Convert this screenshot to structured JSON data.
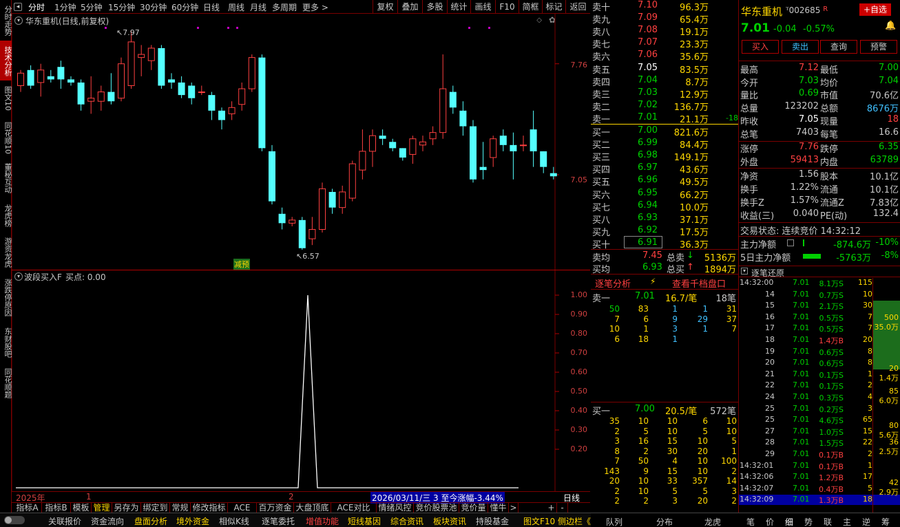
{
  "left_tabs": [
    {
      "label": "分时走势",
      "active": false
    },
    {
      "label": "技术分析",
      "active": true
    },
    {
      "label": "图文10",
      "active": false
    },
    {
      "label": "同花顺10",
      "active": false
    },
    {
      "label": "董秘互动",
      "active": false
    },
    {
      "label": "龙虎榜",
      "active": false
    },
    {
      "label": "游资龙虎",
      "active": false
    },
    {
      "label": "涨跌停原因",
      "active": false
    },
    {
      "label": "东财股吧",
      "active": false
    },
    {
      "label": "同花顺题",
      "active": false
    }
  ],
  "toolbar": {
    "periods": [
      "分时",
      "1分钟",
      "5分钟",
      "15分钟",
      "30分钟",
      "60分钟",
      "日线",
      "周线",
      "月线",
      "多周期",
      "更多 >"
    ],
    "right": [
      "复权",
      "叠加",
      "多股",
      "统计",
      "画线",
      "F10",
      "简框",
      "标记",
      "返回"
    ]
  },
  "kchart": {
    "title": "华东重机(日线,前复权)",
    "high_label": "7.97",
    "low_label": "6.57",
    "y_labels": [
      "7.76",
      "7.05"
    ],
    "marker": "减预",
    "candles": [
      [
        7.62,
        7.7,
        7.58,
        7.72
      ],
      [
        7.72,
        7.62,
        7.6,
        7.75
      ],
      [
        7.64,
        7.72,
        7.55,
        7.76
      ],
      [
        7.68,
        7.66,
        7.64,
        7.72
      ],
      [
        7.74,
        7.66,
        7.6,
        7.78
      ],
      [
        7.66,
        7.64,
        7.62,
        7.68
      ],
      [
        7.64,
        7.5,
        7.46,
        7.66
      ],
      [
        7.52,
        7.54,
        7.44,
        7.68
      ],
      [
        7.52,
        7.58,
        7.46,
        7.62
      ],
      [
        7.58,
        7.52,
        7.5,
        7.7
      ],
      [
        7.54,
        7.76,
        7.52,
        7.8
      ],
      [
        7.62,
        7.9,
        7.6,
        7.97
      ],
      [
        7.8,
        7.82,
        7.68,
        7.88
      ],
      [
        7.78,
        7.86,
        7.72,
        7.88
      ],
      [
        7.86,
        7.62,
        7.6,
        7.88
      ],
      [
        7.66,
        7.64,
        7.6,
        7.7
      ],
      [
        7.64,
        7.56,
        7.54,
        7.68
      ],
      [
        7.62,
        7.54,
        7.5,
        7.64
      ],
      [
        7.58,
        7.58,
        7.56,
        7.62
      ],
      [
        7.56,
        7.46,
        7.4,
        7.58
      ],
      [
        7.46,
        7.4,
        7.34,
        7.48
      ],
      [
        7.44,
        7.48,
        7.4,
        7.52
      ],
      [
        7.5,
        7.6,
        7.46,
        7.64
      ],
      [
        7.6,
        7.8,
        7.58,
        7.82
      ],
      [
        7.8,
        7.22,
        7.2,
        7.82
      ],
      [
        7.2,
        6.88,
        6.86,
        7.24
      ],
      [
        6.8,
        6.74,
        6.7,
        6.84
      ],
      [
        6.74,
        6.76,
        6.72,
        6.78
      ],
      [
        6.76,
        6.58,
        6.57,
        6.78
      ],
      [
        6.64,
        6.7,
        6.6,
        6.78
      ],
      [
        6.7,
        6.96,
        6.68,
        7.0
      ],
      [
        6.94,
        6.84,
        6.8,
        6.96
      ],
      [
        6.84,
        6.94,
        6.8,
        6.98
      ],
      [
        6.9,
        7.12,
        6.88,
        7.14
      ],
      [
        7.08,
        7.2,
        7.02,
        7.34
      ],
      [
        7.2,
        7.3,
        7.1,
        7.34
      ],
      [
        7.3,
        7.28,
        7.24,
        7.34
      ],
      [
        7.26,
        7.22,
        7.2,
        7.28
      ],
      [
        7.22,
        7.16,
        7.14,
        7.22
      ],
      [
        7.18,
        7.28,
        7.12,
        7.3
      ],
      [
        7.24,
        7.26,
        7.2,
        7.3
      ],
      [
        7.28,
        7.32,
        7.24,
        7.36
      ],
      [
        7.32,
        7.6,
        7.28,
        7.82
      ],
      [
        7.58,
        7.48,
        7.44,
        7.62
      ],
      [
        7.46,
        7.36,
        7.3,
        7.52
      ],
      [
        7.36,
        7.02,
        7.0,
        7.4
      ],
      [
        7.1,
        7.08,
        7.02,
        7.26
      ],
      [
        7.16,
        7.28,
        7.1,
        7.3
      ],
      [
        7.3,
        7.24,
        7.2,
        7.34
      ],
      [
        7.24,
        7.2,
        7.02,
        7.32
      ],
      [
        7.24,
        7.24,
        7.2,
        7.3
      ],
      [
        7.34,
        7.2,
        7.1,
        7.46
      ],
      [
        7.2,
        7.1,
        7.06,
        7.2
      ],
      [
        7.06,
        7.04,
        7.02,
        7.1
      ]
    ]
  },
  "indicator": {
    "title": "波段买入F",
    "value_label": "买点: 0.00",
    "y_labels": [
      "1.00",
      "0.90",
      "0.80",
      "0.70",
      "0.60",
      "0.50",
      "0.40",
      "0.30",
      "0.20"
    ]
  },
  "chart_data": {
    "type": "line",
    "title": "波段买入F",
    "ylim": [
      0,
      1.05
    ],
    "peak_value": 1.0,
    "base_value": 0.0
  },
  "date_bar": {
    "year": "2025年",
    "m1": "1",
    "m2": "2",
    "info": "2026/03/11/三 3 至今涨幅-3.44%",
    "period": "日线"
  },
  "indicator_tabs": [
    "指标A",
    "指标B",
    "模板",
    "管理",
    "另存为",
    "绑定到",
    "常规",
    "修改指标",
    "ACE",
    "百万资金",
    "大盘顶底",
    "ACE对比",
    "情绪风控",
    "竞价股票池",
    "竞价量",
    "懂牛",
    ">",
    "+",
    "-"
  ],
  "status_bar": [
    {
      "label": "关联报价",
      "color": "#c8c8c8"
    },
    {
      "label": "资金流向",
      "color": "#c8c8c8"
    },
    {
      "label": "盘面分析",
      "color": "#ffd700"
    },
    {
      "label": "境外资金",
      "color": "#ffd700"
    },
    {
      "label": "相似K线",
      "color": "#c8c8c8"
    },
    {
      "label": "逐笔委托",
      "color": "#c8c8c8"
    },
    {
      "label": "增值功能",
      "color": "#ff4040"
    },
    {
      "label": "短线基因",
      "color": "#ffd700"
    },
    {
      "label": "综合资讯",
      "color": "#ffd700"
    },
    {
      "label": "板块资讯",
      "color": "#ffd700"
    },
    {
      "label": "持股基金",
      "color": "#c8c8c8"
    },
    {
      "label": "图文F10 侧边栏《",
      "color": "#ffd700"
    }
  ],
  "mid_bottom_tabs": [
    "队列",
    "分布",
    "龙虎"
  ],
  "right_bottom_tabs": [
    "笔",
    "价",
    "细",
    "势",
    "联",
    "主",
    "逆",
    "筹"
  ],
  "orderbook": {
    "asks": [
      [
        "卖十",
        "7.10",
        "96.3万"
      ],
      [
        "卖九",
        "7.09",
        "65.4万"
      ],
      [
        "卖八",
        "7.08",
        "19.1万"
      ],
      [
        "卖七",
        "7.07",
        "23.3万"
      ],
      [
        "卖六",
        "7.06",
        "35.6万"
      ],
      [
        "卖五",
        "7.05",
        "83.5万"
      ],
      [
        "卖四",
        "7.04",
        "8.7万"
      ],
      [
        "卖三",
        "7.03",
        "12.9万"
      ],
      [
        "卖二",
        "7.02",
        "136.7万"
      ],
      [
        "卖一",
        "7.01",
        "21.1万"
      ]
    ],
    "ask1_change": "-18",
    "bids": [
      [
        "买一",
        "7.00",
        "821.6万"
      ],
      [
        "买二",
        "6.99",
        "84.4万"
      ],
      [
        "买三",
        "6.98",
        "149.1万"
      ],
      [
        "买四",
        "6.97",
        "43.6万"
      ],
      [
        "买五",
        "6.96",
        "49.5万"
      ],
      [
        "买六",
        "6.95",
        "66.2万"
      ],
      [
        "买七",
        "6.94",
        "10.0万"
      ],
      [
        "买八",
        "6.93",
        "37.1万"
      ],
      [
        "买九",
        "6.92",
        "17.5万"
      ],
      [
        "买十",
        "6.91",
        "36.3万"
      ]
    ],
    "ask_avg": {
      "label": "卖均",
      "price": "7.45",
      "tlabel": "总卖",
      "vol": "5136万"
    },
    "bid_avg": {
      "label": "买均",
      "price": "6.93",
      "tlabel": "总买",
      "vol": "1894万"
    }
  },
  "zbfx": {
    "tab": "逐笔分析",
    "link": "查看千档盘口",
    "sell1": {
      "label": "卖一",
      "price": "7.01",
      "per": "16.7/笔",
      "count": "18笔"
    },
    "sell_grid": [
      [
        "50",
        "83",
        "1",
        "1",
        "31"
      ],
      [
        "7",
        "6",
        "9",
        "29",
        "37"
      ],
      [
        "10",
        "1",
        "3",
        "1",
        "7"
      ],
      [
        "6",
        "18",
        "1",
        "",
        ""
      ]
    ],
    "buy1": {
      "label": "买一",
      "price": "7.00",
      "per": "20.5/笔",
      "count": "572笔"
    },
    "buy_grid": [
      [
        "35",
        "10",
        "10",
        "6",
        "10"
      ],
      [
        "2",
        "5",
        "10",
        "5",
        "10"
      ],
      [
        "3",
        "16",
        "15",
        "10",
        "5"
      ],
      [
        "8",
        "2",
        "30",
        "20",
        "1"
      ],
      [
        "7",
        "50",
        "4",
        "10",
        "100"
      ],
      [
        "143",
        "9",
        "15",
        "10",
        "2"
      ],
      [
        "20",
        "10",
        "33",
        "357",
        "14"
      ],
      [
        "2",
        "10",
        "5",
        "5",
        "3"
      ],
      [
        "2",
        "2",
        "3",
        "20",
        "2"
      ]
    ]
  },
  "quote": {
    "name": "华东重机",
    "code": "002685",
    "r": "R",
    "add_btn": "+自选",
    "price": "7.01",
    "chg": "-0.04",
    "pct": "-0.57%",
    "buttons": [
      "买入",
      "卖出",
      "查询",
      "预警"
    ],
    "rows": [
      [
        "最高",
        "7.12",
        "最低",
        "7.00"
      ],
      [
        "今开",
        "7.03",
        "均价",
        "7.04"
      ],
      [
        "量比",
        "0.69",
        "市值",
        "70.6亿"
      ],
      [
        "总量",
        "123202",
        "总额",
        "8676万"
      ],
      [
        "昨收",
        "7.05",
        "现量",
        "18"
      ],
      [
        "总笔",
        "7403",
        "每笔",
        "16.6"
      ],
      [
        "涨停",
        "7.76",
        "跌停",
        "6.35"
      ],
      [
        "外盘",
        "59413",
        "内盘",
        "63789"
      ],
      [
        "净资",
        "1.56",
        "股本",
        "10.1亿"
      ],
      [
        "换手",
        "1.22%",
        "流通",
        "10.1亿"
      ],
      [
        "换手Z",
        "1.57%",
        "流通Z",
        "7.83亿"
      ],
      [
        "收益(三)",
        "0.040",
        "PE(动)",
        "132.4"
      ]
    ],
    "status_label": "交易状态: 连续竞价",
    "time": "14:32:12",
    "flow1": {
      "label": "主力净额",
      "val": "-874.6万",
      "pct": "-10%"
    },
    "flow2": {
      "label": "5日主力净额",
      "val": "-5763万",
      "pct": "-8%"
    }
  },
  "ticks": {
    "title": "逐笔还原",
    "rows": [
      [
        "14:32:00",
        "7.01",
        "8.1万S",
        "115"
      ],
      [
        "14",
        "7.01",
        "0.7万S",
        "10"
      ],
      [
        "15",
        "7.01",
        "2.1万S",
        "30"
      ],
      [
        "16",
        "7.01",
        "0.5万S",
        "7"
      ],
      [
        "17",
        "7.01",
        "0.5万S",
        "7"
      ],
      [
        "18",
        "7.01",
        "1.4万B",
        "20"
      ],
      [
        "19",
        "7.01",
        "0.6万S",
        "8"
      ],
      [
        "20",
        "7.01",
        "0.6万S",
        "8"
      ],
      [
        "21",
        "7.01",
        "0.1万S",
        "1"
      ],
      [
        "22",
        "7.01",
        "0.1万S",
        "2"
      ],
      [
        "24",
        "7.01",
        "0.3万S",
        "4"
      ],
      [
        "25",
        "7.01",
        "0.2万S",
        "3"
      ],
      [
        "25",
        "7.01",
        "4.6万S",
        "65"
      ],
      [
        "27",
        "7.01",
        "1.0万S",
        "15"
      ],
      [
        "28",
        "7.01",
        "1.5万S",
        "22"
      ],
      [
        "29",
        "7.01",
        "0.1万B",
        "2"
      ],
      [
        "14:32:01",
        "7.01",
        "0.1万B",
        "1"
      ],
      [
        "14:32:06",
        "7.01",
        "1.2万B",
        "17"
      ],
      [
        "14:32:07",
        "7.01",
        "0.4万B",
        "5"
      ],
      [
        "14:32:09",
        "7.01",
        "1.3万B",
        "18"
      ]
    ],
    "bar_labels": [
      [
        "500",
        "35.0万"
      ],
      [
        "20",
        "1.4万"
      ],
      [
        "85",
        "6.0万"
      ],
      [
        "80",
        "5.6万"
      ],
      [
        "36",
        "2.5万"
      ],
      [
        "42",
        "2.9万"
      ]
    ]
  }
}
